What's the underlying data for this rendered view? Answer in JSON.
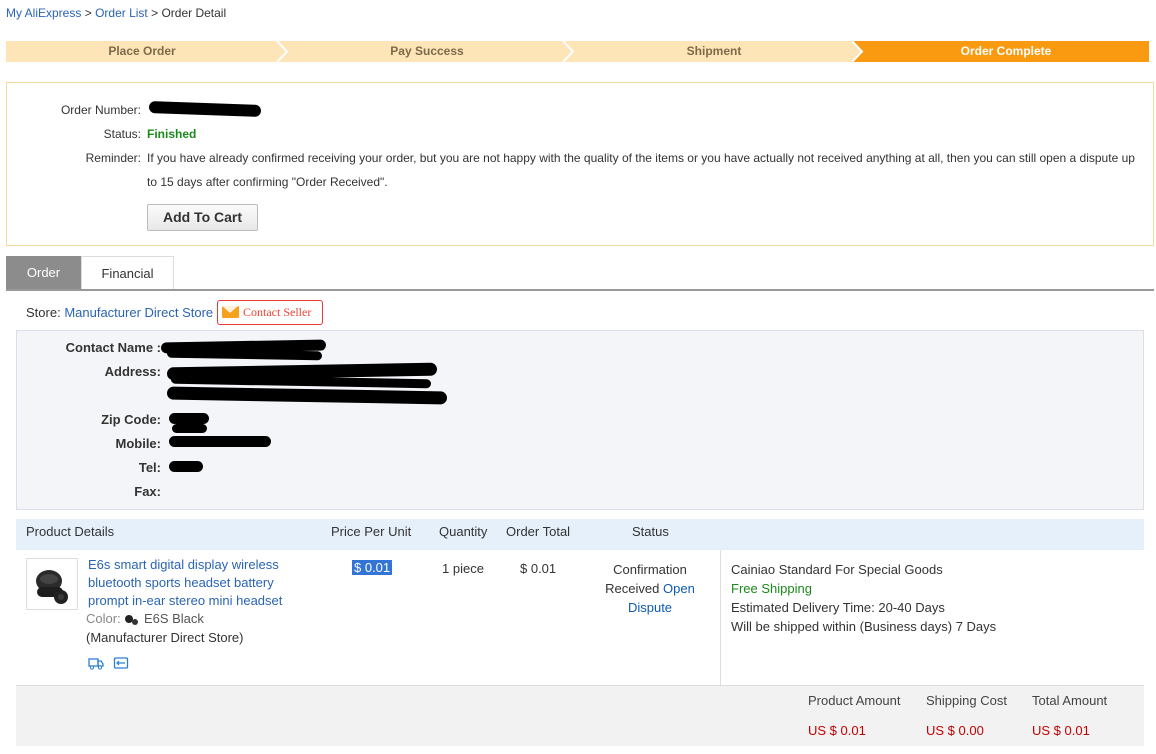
{
  "breadcrumb": {
    "home": "My AliExpress",
    "sep1": ">",
    "list": "Order List",
    "sep2": ">",
    "current": "Order Detail"
  },
  "steps": [
    "Place Order",
    "Pay Success",
    "Shipment",
    "Order Complete"
  ],
  "order_info": {
    "number_label": "Order Number:",
    "status_label": "Status:",
    "status_value": "Finished",
    "reminder_label": "Reminder:",
    "reminder_text": "If you have already confirmed receiving your order, but you are not happy with the quality of the items or you have actually not received anything at all, then you can still open a dispute up to 15 days after confirming \"Order Received\".",
    "add_to_cart": "Add To Cart"
  },
  "tabs": {
    "order": "Order",
    "financial": "Financial"
  },
  "store": {
    "label": "Store:",
    "name": "Manufacturer Direct Store",
    "contact": "Contact Seller"
  },
  "address": {
    "contact_name": "Contact Name :",
    "address": "Address:",
    "zip": "Zip Code:",
    "mobile": "Mobile:",
    "tel": "Tel:",
    "fax": "Fax:"
  },
  "table": {
    "headers": {
      "product": "Product Details",
      "price": "Price Per Unit",
      "quantity": "Quantity",
      "total": "Order Total",
      "status": "Status"
    },
    "row": {
      "name": "E6s smart digital display wireless bluetooth sports headset battery prompt in-ear stereo mini headset",
      "color_label": "Color:",
      "color_value": "E6S Black",
      "store": "(Manufacturer Direct Store)",
      "price": "$ 0.01",
      "quantity": "1 piece",
      "total": "$ 0.01",
      "status_text": "Confirmation Received",
      "status_link": "Open Dispute",
      "shipping_method": "Cainiao Standard For Special Goods",
      "shipping_fee": "Free Shipping",
      "delivery_time": "Estimated Delivery Time: 20-40 Days",
      "ship_within": "Will be shipped within (Business days) 7 Days"
    }
  },
  "totals": {
    "product_label": "Product Amount",
    "shipping_label": "Shipping Cost",
    "total_label": "Total Amount",
    "product_value": "US $ 0.01",
    "shipping_value": "US $ 0.00",
    "total_value": "US $ 0.01"
  },
  "colors": {
    "accent": "#f99a10",
    "link": "#2a64b4",
    "success": "#1b8a1b",
    "price": "#c40000"
  }
}
